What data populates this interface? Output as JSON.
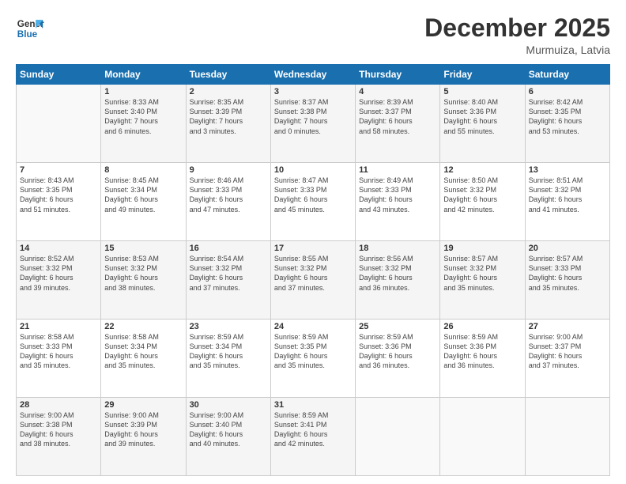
{
  "logo": {
    "line1": "General",
    "line2": "Blue"
  },
  "header": {
    "month": "December 2025",
    "location": "Murmuiza, Latvia"
  },
  "weekdays": [
    "Sunday",
    "Monday",
    "Tuesday",
    "Wednesday",
    "Thursday",
    "Friday",
    "Saturday"
  ],
  "weeks": [
    [
      {
        "day": "",
        "detail": ""
      },
      {
        "day": "1",
        "detail": "Sunrise: 8:33 AM\nSunset: 3:40 PM\nDaylight: 7 hours\nand 6 minutes."
      },
      {
        "day": "2",
        "detail": "Sunrise: 8:35 AM\nSunset: 3:39 PM\nDaylight: 7 hours\nand 3 minutes."
      },
      {
        "day": "3",
        "detail": "Sunrise: 8:37 AM\nSunset: 3:38 PM\nDaylight: 7 hours\nand 0 minutes."
      },
      {
        "day": "4",
        "detail": "Sunrise: 8:39 AM\nSunset: 3:37 PM\nDaylight: 6 hours\nand 58 minutes."
      },
      {
        "day": "5",
        "detail": "Sunrise: 8:40 AM\nSunset: 3:36 PM\nDaylight: 6 hours\nand 55 minutes."
      },
      {
        "day": "6",
        "detail": "Sunrise: 8:42 AM\nSunset: 3:35 PM\nDaylight: 6 hours\nand 53 minutes."
      }
    ],
    [
      {
        "day": "7",
        "detail": "Sunrise: 8:43 AM\nSunset: 3:35 PM\nDaylight: 6 hours\nand 51 minutes."
      },
      {
        "day": "8",
        "detail": "Sunrise: 8:45 AM\nSunset: 3:34 PM\nDaylight: 6 hours\nand 49 minutes."
      },
      {
        "day": "9",
        "detail": "Sunrise: 8:46 AM\nSunset: 3:33 PM\nDaylight: 6 hours\nand 47 minutes."
      },
      {
        "day": "10",
        "detail": "Sunrise: 8:47 AM\nSunset: 3:33 PM\nDaylight: 6 hours\nand 45 minutes."
      },
      {
        "day": "11",
        "detail": "Sunrise: 8:49 AM\nSunset: 3:33 PM\nDaylight: 6 hours\nand 43 minutes."
      },
      {
        "day": "12",
        "detail": "Sunrise: 8:50 AM\nSunset: 3:32 PM\nDaylight: 6 hours\nand 42 minutes."
      },
      {
        "day": "13",
        "detail": "Sunrise: 8:51 AM\nSunset: 3:32 PM\nDaylight: 6 hours\nand 41 minutes."
      }
    ],
    [
      {
        "day": "14",
        "detail": "Sunrise: 8:52 AM\nSunset: 3:32 PM\nDaylight: 6 hours\nand 39 minutes."
      },
      {
        "day": "15",
        "detail": "Sunrise: 8:53 AM\nSunset: 3:32 PM\nDaylight: 6 hours\nand 38 minutes."
      },
      {
        "day": "16",
        "detail": "Sunrise: 8:54 AM\nSunset: 3:32 PM\nDaylight: 6 hours\nand 37 minutes."
      },
      {
        "day": "17",
        "detail": "Sunrise: 8:55 AM\nSunset: 3:32 PM\nDaylight: 6 hours\nand 37 minutes."
      },
      {
        "day": "18",
        "detail": "Sunrise: 8:56 AM\nSunset: 3:32 PM\nDaylight: 6 hours\nand 36 minutes."
      },
      {
        "day": "19",
        "detail": "Sunrise: 8:57 AM\nSunset: 3:32 PM\nDaylight: 6 hours\nand 35 minutes."
      },
      {
        "day": "20",
        "detail": "Sunrise: 8:57 AM\nSunset: 3:33 PM\nDaylight: 6 hours\nand 35 minutes."
      }
    ],
    [
      {
        "day": "21",
        "detail": "Sunrise: 8:58 AM\nSunset: 3:33 PM\nDaylight: 6 hours\nand 35 minutes."
      },
      {
        "day": "22",
        "detail": "Sunrise: 8:58 AM\nSunset: 3:34 PM\nDaylight: 6 hours\nand 35 minutes."
      },
      {
        "day": "23",
        "detail": "Sunrise: 8:59 AM\nSunset: 3:34 PM\nDaylight: 6 hours\nand 35 minutes."
      },
      {
        "day": "24",
        "detail": "Sunrise: 8:59 AM\nSunset: 3:35 PM\nDaylight: 6 hours\nand 35 minutes."
      },
      {
        "day": "25",
        "detail": "Sunrise: 8:59 AM\nSunset: 3:36 PM\nDaylight: 6 hours\nand 36 minutes."
      },
      {
        "day": "26",
        "detail": "Sunrise: 8:59 AM\nSunset: 3:36 PM\nDaylight: 6 hours\nand 36 minutes."
      },
      {
        "day": "27",
        "detail": "Sunrise: 9:00 AM\nSunset: 3:37 PM\nDaylight: 6 hours\nand 37 minutes."
      }
    ],
    [
      {
        "day": "28",
        "detail": "Sunrise: 9:00 AM\nSunset: 3:38 PM\nDaylight: 6 hours\nand 38 minutes."
      },
      {
        "day": "29",
        "detail": "Sunrise: 9:00 AM\nSunset: 3:39 PM\nDaylight: 6 hours\nand 39 minutes."
      },
      {
        "day": "30",
        "detail": "Sunrise: 9:00 AM\nSunset: 3:40 PM\nDaylight: 6 hours\nand 40 minutes."
      },
      {
        "day": "31",
        "detail": "Sunrise: 8:59 AM\nSunset: 3:41 PM\nDaylight: 6 hours\nand 42 minutes."
      },
      {
        "day": "",
        "detail": ""
      },
      {
        "day": "",
        "detail": ""
      },
      {
        "day": "",
        "detail": ""
      }
    ]
  ]
}
